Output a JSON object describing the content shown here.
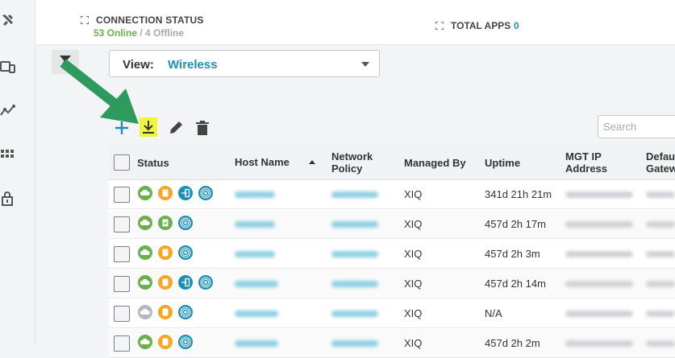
{
  "connection": {
    "title": "CONNECTION STATUS",
    "online": "53 Online",
    "separator": " / ",
    "offline": "4 Offline"
  },
  "apps": {
    "title": "TOTAL APPS",
    "count": "0"
  },
  "view": {
    "label": "View:",
    "value": "Wireless"
  },
  "search": {
    "placeholder": "Search"
  },
  "table": {
    "columns": {
      "status": "Status",
      "hostname": "Host Name",
      "policy_line1": "Network",
      "policy_line2": "Policy",
      "managed_by": "Managed By",
      "uptime": "Uptime",
      "mgt_line1": "MGT IP",
      "mgt_line2": "Address",
      "gw_line1": "Defau",
      "gw_line2": "Gatew"
    },
    "rows": [
      {
        "managed_by": "XIQ",
        "uptime": "341d 21h 21m",
        "icons": [
          "cloud-green",
          "clipboard-orange",
          "login-teal",
          "radio-teal"
        ]
      },
      {
        "managed_by": "XIQ",
        "uptime": "457d 2h 17m",
        "icons": [
          "cloud-green",
          "clipboard-check-green",
          "radio-teal"
        ]
      },
      {
        "managed_by": "XIQ",
        "uptime": "457d 2h 3m",
        "icons": [
          "cloud-green",
          "clipboard-orange",
          "radio-teal"
        ]
      },
      {
        "managed_by": "XIQ",
        "uptime": "457d 2h 14m",
        "icons": [
          "cloud-green",
          "clipboard-orange",
          "login-teal",
          "radio-teal"
        ]
      },
      {
        "managed_by": "XIQ",
        "uptime": "N/A",
        "icons": [
          "cloud-gray",
          "clipboard-orange",
          "radio-teal"
        ]
      },
      {
        "managed_by": "XIQ",
        "uptime": "457d 2h 2m",
        "icons": [
          "cloud-green",
          "clipboard-orange",
          "radio-teal"
        ]
      }
    ]
  },
  "colors": {
    "accent": "#1b8fb5",
    "online": "#6ab04c",
    "arrow": "#2e9a5e",
    "highlight": "#f3f53a"
  }
}
